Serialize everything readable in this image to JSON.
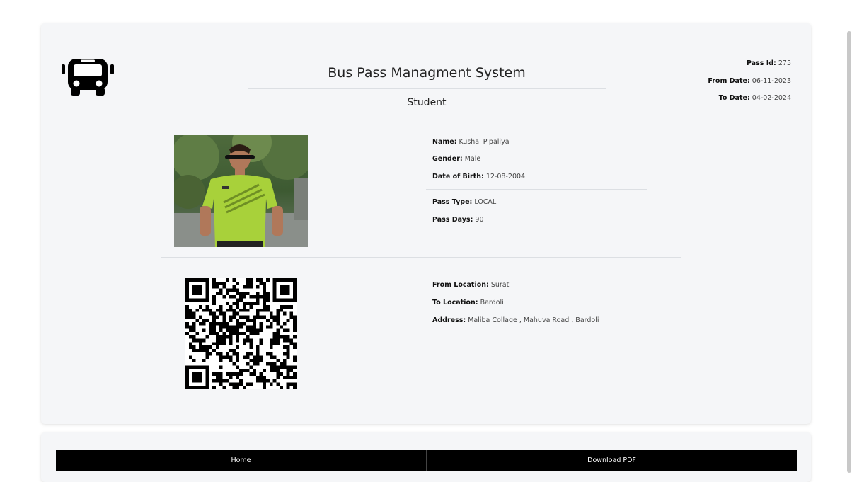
{
  "header": {
    "title": "Bus Pass Managment System",
    "subtitle": "Student",
    "icon": "bus-icon"
  },
  "pass_meta": {
    "pass_id_label": "Pass Id:",
    "pass_id": "275",
    "from_date_label": "From Date:",
    "from_date": "06-11-2023",
    "to_date_label": "To Date:",
    "to_date": "04-02-2024"
  },
  "student": {
    "photo": "student-photo",
    "name_label": "Name:",
    "name": "Kushal Pipaliya",
    "gender_label": "Gender:",
    "gender": "Male",
    "dob_label": "Date of Birth:",
    "dob": "12-08-2004",
    "pass_type_label": "Pass Type:",
    "pass_type": "LOCAL",
    "pass_days_label": "Pass Days:",
    "pass_days": "90"
  },
  "route": {
    "qr": "qr-code",
    "from_label": "From Location:",
    "from": "Surat",
    "to_label": "To Location:",
    "to": "Bardoli",
    "address_label": "Address:",
    "address": "Maliba Collage , Mahuva Road , Bardoli"
  },
  "nav": {
    "home": "Home",
    "download": "Download PDF"
  },
  "colors": {
    "card_bg": "#f5f6f8",
    "nav_bg": "#000000",
    "shirt": "#a8d13a"
  }
}
